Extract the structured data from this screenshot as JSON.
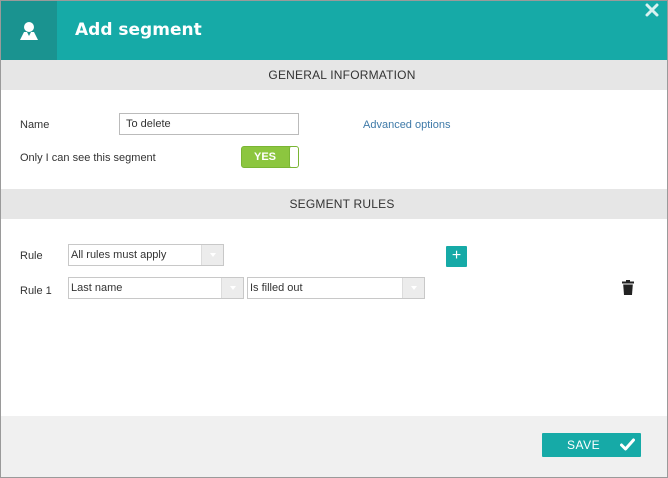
{
  "header": {
    "title": "Add segment",
    "icon": "user-icon",
    "close_icon": "close-icon",
    "accent_color": "#16aaa7"
  },
  "general": {
    "section_title": "General Information",
    "name_label": "Name",
    "name_value": "To delete",
    "advanced_link": "Advanced options",
    "visibility_label": "Only I can see this segment",
    "visibility_toggle": "YES",
    "toggle_color": "#8cc63f"
  },
  "rules": {
    "section_title": "Segment Rules",
    "rule_label": "Rule",
    "rule_mode": "All rules must apply",
    "add_icon": "plus-icon",
    "items": [
      {
        "label": "Rule 1",
        "field": "Last name",
        "condition": "Is filled out",
        "delete_icon": "trash-icon"
      }
    ]
  },
  "footer": {
    "save_label": "SAVE",
    "save_icon": "check-icon"
  }
}
